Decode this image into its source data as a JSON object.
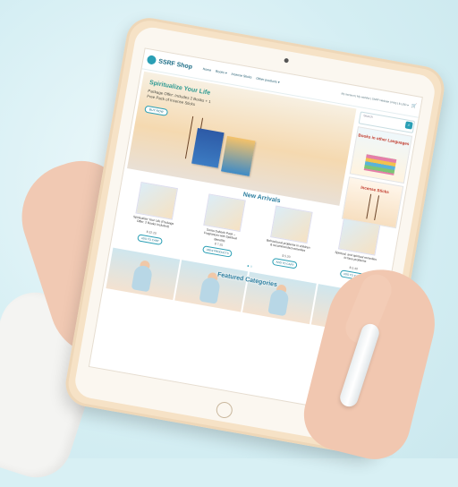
{
  "header": {
    "logo_text": "SSRF Shop",
    "nav": [
      "Home",
      "Books ▾",
      "Incense Sticks",
      "Other products ▾"
    ],
    "utility_text": "My account | My wishlist | SSRF Website | FAQ | $ USD ▾",
    "cart_icon": "cart-icon"
  },
  "hero": {
    "title": "Spiritualize Your Life",
    "subtitle": "Package Offer: Includes 2 Books + 1 Free Pack of Incense Sticks",
    "button": "BUY NOW"
  },
  "search": {
    "placeholder": "Search",
    "icon": "search-icon"
  },
  "side_cards": [
    {
      "title": "Books in other Languages"
    },
    {
      "title": "Incense Sticks"
    }
  ],
  "new_arrivals": {
    "title": "New Arrivals",
    "products": [
      {
        "name": "Spiritualize Your Life (Package Offer: 2 Books Included)",
        "price": "$ 32.20",
        "button": "ADD TO CART"
      },
      {
        "name": "Soma Subash Pack – Fragrances with Spiritual Benefits",
        "price": "$ 7.25",
        "button": "VIEW PRODUCTS"
      },
      {
        "name": "Behavioural problems in children & recommended remedies",
        "price": "$ 5.20",
        "button": "ADD TO CART"
      },
      {
        "name": "Spiritual, and spiritual remedies to face problems",
        "price": "$ 5.40",
        "button": "ADD TO CART"
      }
    ],
    "dots": "● ○"
  },
  "featured": {
    "title": "Featured Categories"
  }
}
